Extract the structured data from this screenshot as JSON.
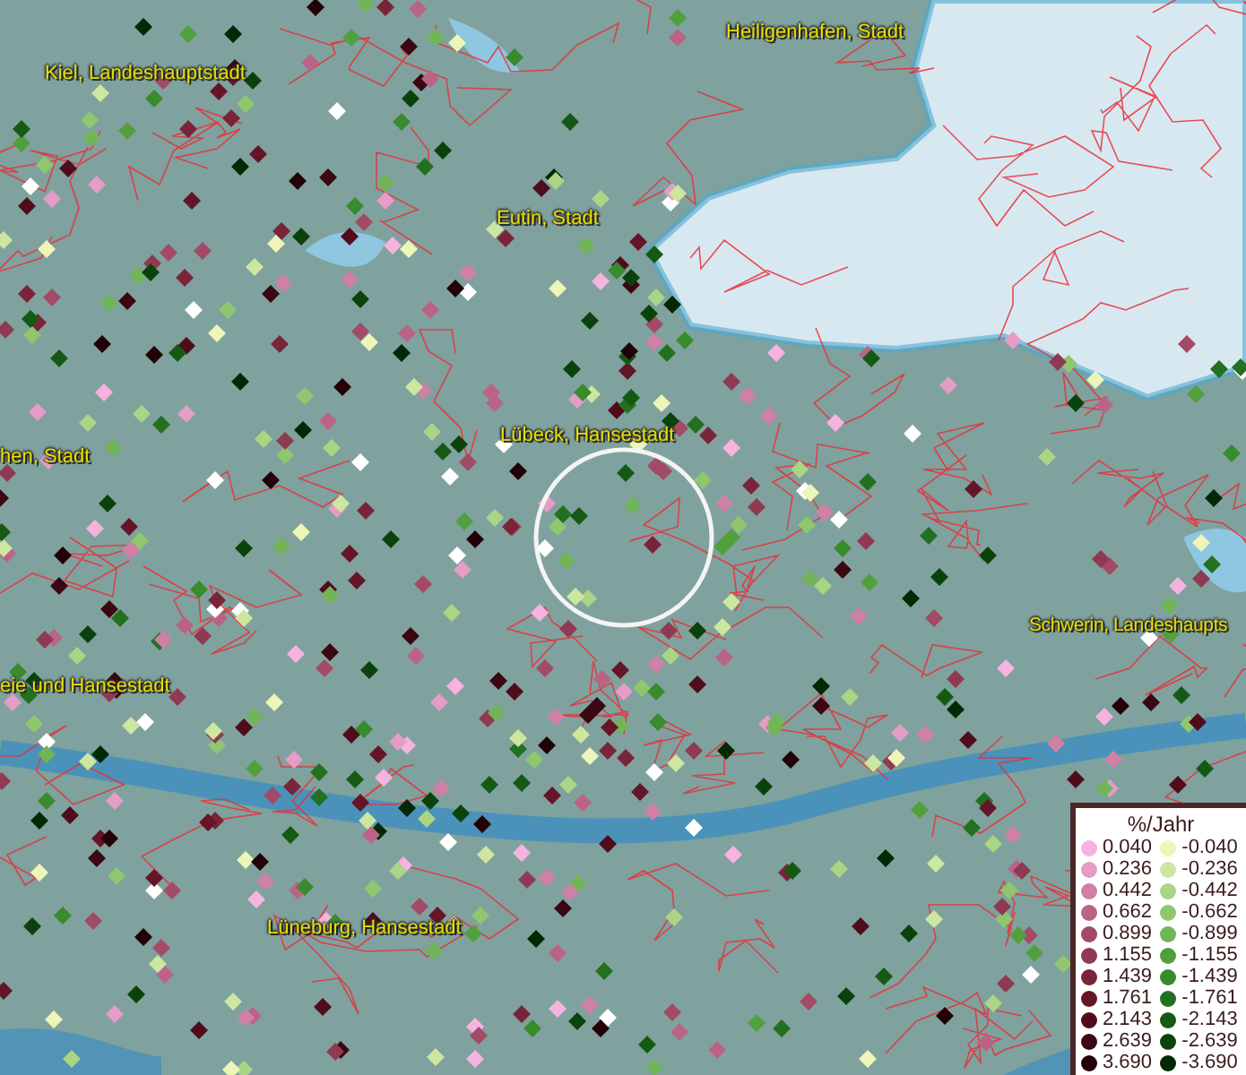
{
  "map": {
    "places": [
      {
        "name": "Kiel, Landeshauptstadt"
      },
      {
        "name": "Heiligenhafen, Stadt"
      },
      {
        "name": "Eutin, Stadt"
      },
      {
        "name": "hen, Stadt"
      },
      {
        "name": "Lübeck, Hansestadt"
      },
      {
        "name": "Schwerin, Landeshaupts"
      },
      {
        "name": "eie und Hansestadt"
      },
      {
        "name": "Lüneburg, Hansestadt"
      }
    ]
  },
  "legend": {
    "title": "%/Jahr",
    "positive": [
      {
        "label": "0.040",
        "color": "#f7b3df"
      },
      {
        "label": "0.236",
        "color": "#e59cc6"
      },
      {
        "label": "0.442",
        "color": "#d07fa7"
      },
      {
        "label": "0.662",
        "color": "#bb6287"
      },
      {
        "label": "0.899",
        "color": "#a34a66"
      },
      {
        "label": "1.155",
        "color": "#8f3a52"
      },
      {
        "label": "1.439",
        "color": "#7a2439"
      },
      {
        "label": "1.761",
        "color": "#651528"
      },
      {
        "label": "2.143",
        "color": "#4f0d1c"
      },
      {
        "label": "2.639",
        "color": "#3a0712"
      },
      {
        "label": "3.690",
        "color": "#220208"
      }
    ],
    "negative": [
      {
        "label": "-0.040",
        "color": "#eef5b8"
      },
      {
        "label": "-0.236",
        "color": "#cde6a0"
      },
      {
        "label": "-0.442",
        "color": "#a9d585"
      },
      {
        "label": "-0.662",
        "color": "#8fc76e"
      },
      {
        "label": "-0.899",
        "color": "#72b458"
      },
      {
        "label": "-1.155",
        "color": "#52a03d"
      },
      {
        "label": "-1.439",
        "color": "#3a8a2e"
      },
      {
        "label": "-1.761",
        "color": "#227020"
      },
      {
        "label": "-2.143",
        "color": "#145a14"
      },
      {
        "label": "-2.639",
        "color": "#0a420c"
      },
      {
        "label": "-3.690",
        "color": "#032806"
      }
    ]
  }
}
